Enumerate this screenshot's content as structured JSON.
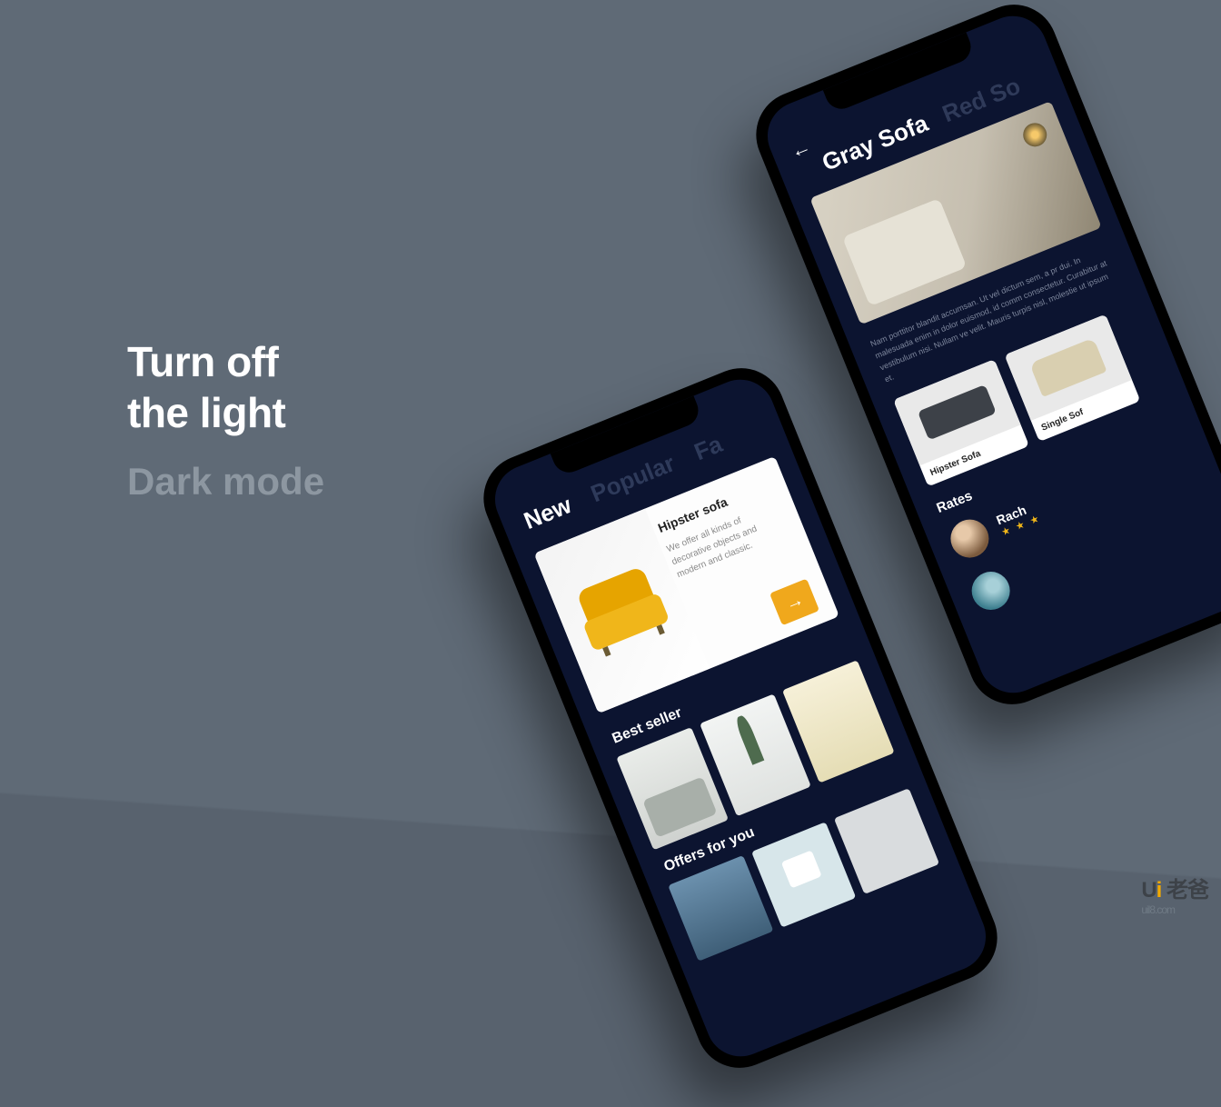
{
  "headline": {
    "line1": "Turn off",
    "line2": "the light",
    "subtitle": "Dark mode"
  },
  "watermark": {
    "brand_prefix": "U",
    "brand_accent": "i",
    "brand_suffix": " 老爸",
    "site": "uil8.com"
  },
  "phone_a": {
    "tabs": {
      "active": "New",
      "t2": "Popular",
      "t3": "Fa"
    },
    "feature": {
      "title": "Hipster sofa",
      "desc": "We offer all kinds of decorative objects and modern and classic."
    },
    "section_bestseller": "Best seller",
    "section_offers": "Offers for you"
  },
  "phone_b": {
    "categories": {
      "active": "Gray Sofa",
      "c2": "Red So"
    },
    "lorem": "Nam porttitor blandit accumsan. Ut vel dictum sem, a pr dui. In malesuada enim in dolor euismod, id comm consectetur. Curabitur at vestibulum nisi. Nullam ve velit. Mauris turpis nisl, molestie ut ipsum et.",
    "cards": {
      "c1": "Hipster Sofa",
      "c2": "Single Sof"
    },
    "rates_title": "Rates",
    "reviewers": {
      "r1": "Rach"
    }
  }
}
